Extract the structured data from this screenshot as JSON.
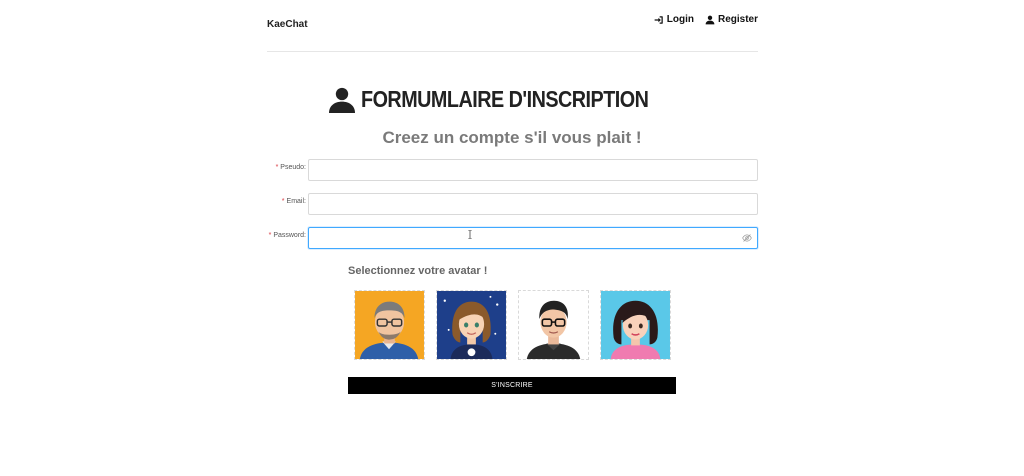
{
  "navbar": {
    "brand": "KaeChat",
    "login_label": "Login",
    "register_label": "Register"
  },
  "form": {
    "title": "FORMUMLAIRE D'INSCRIPTION",
    "subtitle": "Creez un compte s'il vous plait !",
    "fields": [
      {
        "label": "Pseudo",
        "required_mark": "*",
        "value": ""
      },
      {
        "label": "Email",
        "required_mark": "*",
        "value": ""
      },
      {
        "label": "Password",
        "required_mark": "*",
        "value": ""
      }
    ],
    "avatar_heading": "Selectionnez votre avatar !",
    "avatars": [
      "man-glasses-avatar",
      "woman-brown-hair-avatar",
      "man-dark-glasses-avatar",
      "woman-black-hair-avatar"
    ],
    "submit_label": "S'INSCRIRE"
  },
  "colors": {
    "required": "#d9363e",
    "focus_border": "#40a9ff",
    "subtitle": "#7a7a7a",
    "button_bg": "#000000"
  }
}
